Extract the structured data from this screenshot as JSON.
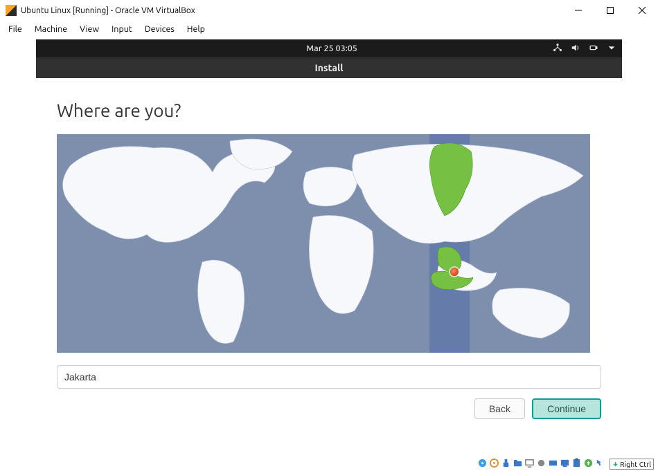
{
  "host": {
    "title": "Ubuntu Linux [Running] - Oracle VM VirtualBox",
    "menus": [
      "File",
      "Machine",
      "View",
      "Input",
      "Devices",
      "Help"
    ],
    "host_key_label": "Right Ctrl"
  },
  "gnome": {
    "clock": "Mar 25  03:05",
    "sys_icons": [
      "network-icon",
      "volume-icon",
      "power-icon",
      "chevron-down-icon"
    ]
  },
  "installer": {
    "window_title": "Install",
    "heading": "Where are you?",
    "location_value": "Jakarta",
    "back_label": "Back",
    "continue_label": "Continue"
  },
  "map": {
    "selected_timezone_band": "UTC+7",
    "highlighted_regions": [
      "Jakarta / Indonesia (western)",
      "Krasnoyarsk region"
    ],
    "pin_label": "Jakarta"
  },
  "colors": {
    "gnome_bar": "#1b1b1b",
    "install_bar": "#313131",
    "map_ocean": "#7e8fad",
    "map_land": "#f6f8fb",
    "highlight_green": "#76c043",
    "tz_band": "#5e79ab",
    "primary_button_border": "#0f9d8f",
    "primary_button_fill": "#b6e6db"
  }
}
